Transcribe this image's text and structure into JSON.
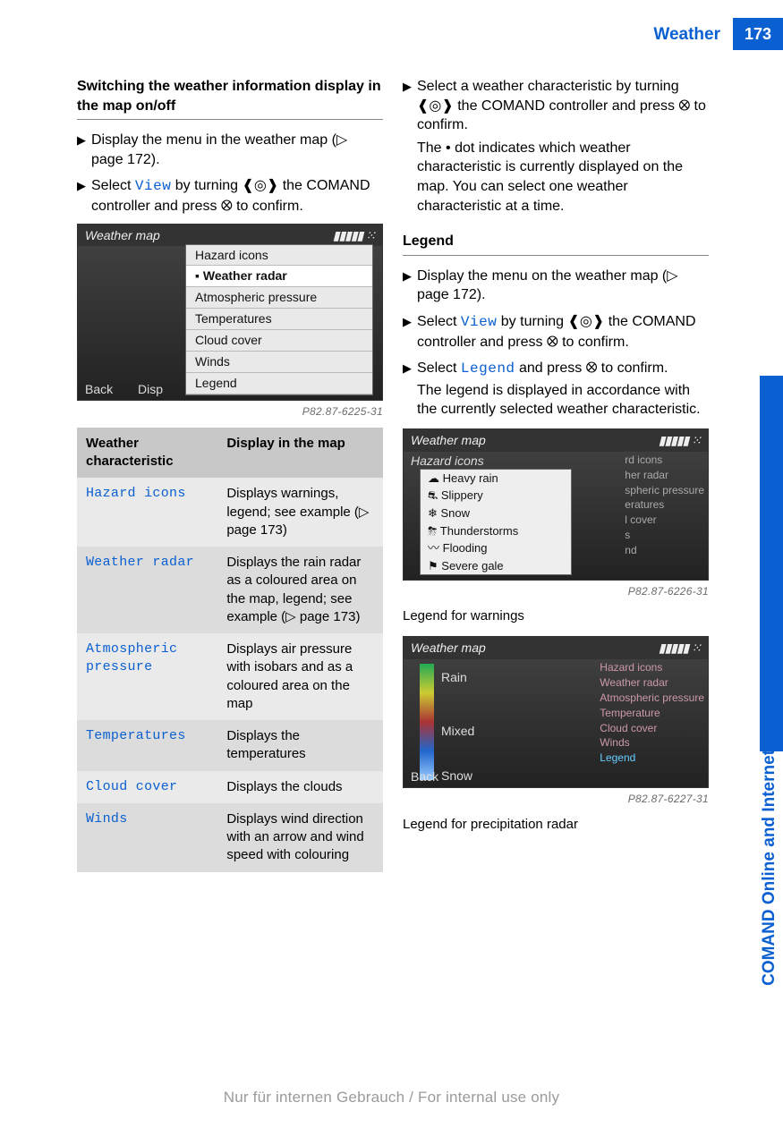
{
  "header": {
    "title": "Weather",
    "page": "173"
  },
  "side": {
    "label": "COMAND Online and Internet"
  },
  "footer": {
    "text": "Nur für internen Gebrauch / For internal use only"
  },
  "left": {
    "section_title": "Switching the weather information display in the map on/off",
    "step1": "Display the menu in the weather map (▷ page 172).",
    "step2a": "Select ",
    "step2_term": "View",
    "step2b": " by turning ",
    "step2c": " the COMAND controller and press ",
    "step2d": " to confirm.",
    "img1_code": "P82.87-6225-31",
    "table": {
      "h1": "Weather characteristic",
      "h2": "Display in the map",
      "rows": [
        {
          "term": "Hazard icons",
          "desc": "Displays warnings, legend; see example (▷ page 173)"
        },
        {
          "term": "Weather radar",
          "desc": "Displays the rain radar as a coloured area on the map, legend; see example (▷ page 173)"
        },
        {
          "term": "Atmospheric pressure",
          "desc": "Displays air pressure with isobars and as a coloured area on the map"
        },
        {
          "term": "Temperatures",
          "desc": "Displays the temperatures"
        },
        {
          "term": "Cloud cover",
          "desc": "Displays the clouds"
        },
        {
          "term": "Winds",
          "desc": "Displays wind direction with an arrow and wind speed with colouring"
        }
      ]
    },
    "screenshot1": {
      "title": "Weather map",
      "menu": [
        "Hazard icons",
        "Weather radar",
        "Atmospheric pressure",
        "Temperatures",
        "Cloud cover",
        "Winds",
        "Legend"
      ],
      "bottom": [
        "Back",
        "Disp"
      ]
    }
  },
  "right": {
    "step1a": "Select a weather characteristic by turning ",
    "step1b": " the COMAND controller and press ",
    "step1c": " to confirm.",
    "step1_note": "The • dot indicates which weather characteristic is currently displayed on the map. You can select one weather characteristic at a time.",
    "legend_head": "Legend",
    "lstep1": "Display the menu on the weather map (▷ page 172).",
    "lstep2a": "Select ",
    "lstep2_term": "View",
    "lstep2b": " by turning ",
    "lstep2c": " the COMAND controller and press ",
    "lstep2d": " to confirm.",
    "lstep3a": "Select ",
    "lstep3_term": "Legend",
    "lstep3b": " and press ",
    "lstep3c": " to confirm.",
    "lstep3_note": "The legend is displayed in accordance with the currently selected weather characteristic.",
    "img2_code": "P82.87-6226-31",
    "img2_caption": "Legend for warnings",
    "img3_code": "P82.87-6227-31",
    "img3_caption": "Legend for precipitation radar",
    "screenshot2": {
      "title": "Weather map",
      "sub": "Hazard icons",
      "panel": [
        "Heavy rain",
        "Slippery",
        "Snow",
        "Thunderstorms",
        "Flooding",
        "Severe gale"
      ],
      "side": [
        "rd icons",
        "her radar",
        "spheric pressure",
        "eratures",
        "l cover",
        "s",
        "nd"
      ]
    },
    "screenshot3": {
      "title": "Weather map",
      "left": [
        "Rain",
        "Mixed",
        "Snow"
      ],
      "side": [
        "Hazard icons",
        "Weather radar",
        "Atmospheric pressure",
        "Temperature",
        "Cloud cover",
        "Winds",
        "Legend"
      ],
      "bottom": [
        "Back"
      ]
    }
  }
}
